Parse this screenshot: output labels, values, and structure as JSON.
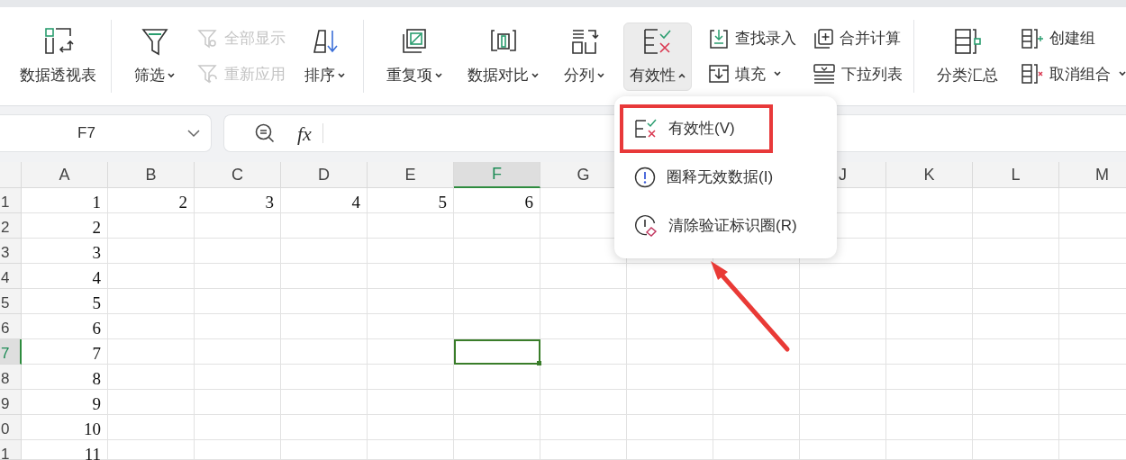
{
  "ribbon": {
    "sections": [
      {
        "controls": [
          {
            "kind": "large",
            "label": "数据透视表",
            "caret": false,
            "expanded": false
          }
        ]
      },
      {
        "controls": [
          {
            "kind": "large",
            "label": "筛选",
            "caret": true,
            "expanded": false
          },
          {
            "kind": "stack",
            "items": [
              {
                "label": "全部显示",
                "disabled": true,
                "caret": false
              },
              {
                "label": "重新应用",
                "disabled": true,
                "caret": false
              }
            ]
          },
          {
            "kind": "large",
            "label": "排序",
            "caret": true,
            "expanded": false
          }
        ]
      },
      {
        "controls": [
          {
            "kind": "large",
            "label": "重复项",
            "caret": true,
            "expanded": false
          },
          {
            "kind": "large",
            "label": "数据对比",
            "caret": true,
            "expanded": false
          },
          {
            "kind": "large",
            "label": "分列",
            "caret": true,
            "expanded": false
          },
          {
            "kind": "large",
            "label": "有效性",
            "caret": true,
            "expanded": true
          },
          {
            "kind": "stack",
            "items": [
              {
                "label": "查找录入",
                "disabled": false,
                "caret": false
              },
              {
                "label": "填充",
                "disabled": false,
                "caret": true
              }
            ]
          },
          {
            "kind": "stack",
            "items": [
              {
                "label": "合并计算",
                "disabled": false,
                "caret": false
              },
              {
                "label": "下拉列表",
                "disabled": false,
                "caret": false
              }
            ]
          }
        ]
      },
      {
        "controls": [
          {
            "kind": "large",
            "label": "分类汇总",
            "caret": false,
            "expanded": false
          },
          {
            "kind": "stack",
            "items": [
              {
                "label": "创建组",
                "disabled": false,
                "caret": false
              },
              {
                "label": "取消组合",
                "disabled": false,
                "caret": true
              }
            ]
          }
        ]
      }
    ]
  },
  "formula_bar": {
    "name_box": "F7",
    "function_label": "fx"
  },
  "sheet": {
    "columns": [
      {
        "label": "A",
        "selected": false
      },
      {
        "label": "B",
        "selected": false
      },
      {
        "label": "C",
        "selected": false
      },
      {
        "label": "D",
        "selected": false
      },
      {
        "label": "E",
        "selected": false
      },
      {
        "label": "F",
        "selected": true
      },
      {
        "label": "G",
        "selected": false
      },
      {
        "label": "J",
        "selected": false
      },
      {
        "label": "K",
        "selected": false
      },
      {
        "label": "L",
        "selected": false
      },
      {
        "label": "M",
        "selected": false
      }
    ],
    "rows": [
      {
        "header": "1",
        "selected": false,
        "cells": [
          "1",
          "2",
          "3",
          "4",
          "5",
          "6"
        ]
      },
      {
        "header": "2",
        "selected": false,
        "cells": [
          "2"
        ]
      },
      {
        "header": "3",
        "selected": false,
        "cells": [
          "3"
        ]
      },
      {
        "header": "4",
        "selected": false,
        "cells": [
          "4"
        ]
      },
      {
        "header": "5",
        "selected": false,
        "cells": [
          "5"
        ]
      },
      {
        "header": "6",
        "selected": false,
        "cells": [
          "6"
        ]
      },
      {
        "header": "7",
        "selected": true,
        "cells": [
          "7"
        ]
      },
      {
        "header": "8",
        "selected": false,
        "cells": [
          "8"
        ]
      },
      {
        "header": "9",
        "selected": false,
        "cells": [
          "9"
        ]
      },
      {
        "header": "0",
        "selected": false,
        "cells": [
          "10"
        ]
      },
      {
        "header": "1",
        "selected": false,
        "cells": [
          "11"
        ]
      }
    ]
  },
  "dropdown_menu": {
    "items": [
      {
        "label": "有效性(V)",
        "highlighted": true
      },
      {
        "label": "圈释无效数据(I)",
        "highlighted": false
      },
      {
        "label": "清除验证标识圈(R)",
        "highlighted": false
      }
    ]
  }
}
